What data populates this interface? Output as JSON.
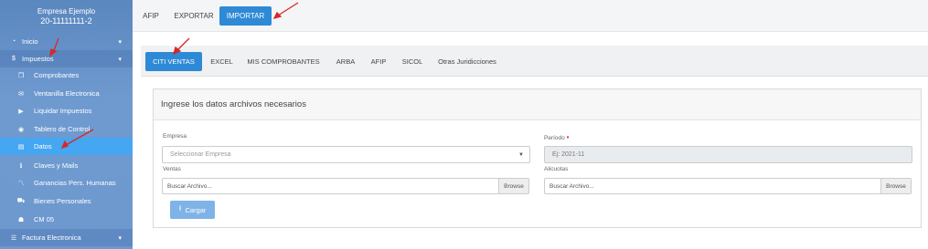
{
  "company": {
    "name": "Empresa Ejemplo",
    "cuit": "20-11111111-2"
  },
  "sidebar": {
    "items": [
      {
        "label": "Inicio",
        "icon": "dashboard-icon"
      },
      {
        "label": "Impuestos",
        "icon": "dollar-icon"
      },
      {
        "label": "Comprobantes",
        "icon": "documents-icon"
      },
      {
        "label": "Ventanilla Electronica",
        "icon": "envelope-icon"
      },
      {
        "label": "Liquidar Impuestos",
        "icon": "play-icon"
      },
      {
        "label": "Tablero de Control",
        "icon": "eye-icon"
      },
      {
        "label": "Datos",
        "icon": "database-icon"
      },
      {
        "label": "Claves y Mails",
        "icon": "info-icon"
      },
      {
        "label": "Ganancias Pers. Humanas",
        "icon": "chart-icon"
      },
      {
        "label": "Bienes Personales",
        "icon": "car-icon"
      },
      {
        "label": "CM 05",
        "icon": "users-icon"
      },
      {
        "label": "Factura Electronica",
        "icon": "list-icon"
      }
    ]
  },
  "top_tabs": [
    "AFIP",
    "EXPORTAR",
    "IMPORTAR"
  ],
  "inner_tabs": [
    "CITI VENTAS",
    "EXCEL",
    "MIS COMPROBANTES",
    "ARBA",
    "AFIP",
    "SICOL",
    "Otras Juridicciones"
  ],
  "panel": {
    "title": "Ingrese los datos archivos necesarios",
    "empresa_label": "Empresa",
    "empresa_placeholder": "Seleccionar Empresa",
    "periodo_label": "Período",
    "periodo_required": "•",
    "periodo_placeholder": "Ej: 2021-11",
    "ventas_label": "Ventas",
    "ventas_placeholder": "Buscar Archivo...",
    "alicuotas_label": "Alicuotas",
    "alicuotas_placeholder": "Buscar Archivo...",
    "browse_label": "Browse",
    "cargar_label": "Cargar"
  },
  "colors": {
    "accent": "#2e8ad6",
    "sidebar": "#6d99cf",
    "active_item": "#45a6f2",
    "annotation": "#d62828"
  }
}
